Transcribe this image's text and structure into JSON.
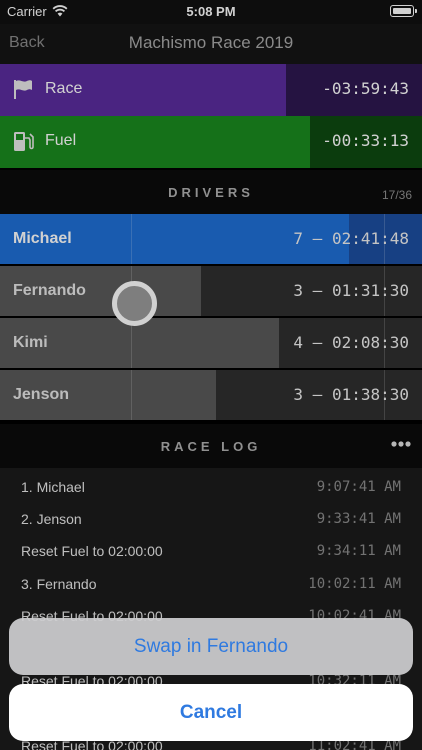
{
  "status_bar": {
    "carrier": "Carrier",
    "time": "5:08 PM"
  },
  "nav": {
    "back_label": "Back",
    "title": "Machismo Race 2019"
  },
  "timers": {
    "race": {
      "label": "Race",
      "value": "-03:59:43",
      "icon": "flag-icon",
      "color": "#5b2d9e"
    },
    "fuel": {
      "label": "Fuel",
      "value": "-00:33:13",
      "icon": "fuel-pump-icon",
      "color": "#1a8a1f"
    }
  },
  "drivers_section": {
    "title": "DRIVERS",
    "count": "17/36"
  },
  "drivers": [
    {
      "name": "Michael",
      "value": "7 — 02:41:48",
      "active": true
    },
    {
      "name": "Fernando",
      "value": "3 — 01:31:30",
      "active": false
    },
    {
      "name": "Kimi",
      "value": "4 — 02:08:30",
      "active": false
    },
    {
      "name": "Jenson",
      "value": "3 — 01:38:30",
      "active": false
    }
  ],
  "log_section": {
    "title": "RACE LOG",
    "more_icon": "more-icon"
  },
  "log": [
    {
      "entry": "1. Michael",
      "time": "9:07:41 AM"
    },
    {
      "entry": "2. Jenson",
      "time": "9:33:41 AM"
    },
    {
      "entry": "Reset Fuel to 02:00:00",
      "time": "9:34:11 AM"
    },
    {
      "entry": "3. Fernando",
      "time": "10:02:11 AM"
    },
    {
      "entry": "Reset Fuel to 02:00:00",
      "time": "10:02:41 AM"
    },
    {
      "entry": "",
      "time": ""
    },
    {
      "entry": "Reset Fuel to 02:00:00",
      "time": "10:32:11 AM"
    },
    {
      "entry": "",
      "time": ""
    },
    {
      "entry": "Reset Fuel to 02:00:00",
      "time": "11:02:41 AM"
    }
  ],
  "action_sheet": {
    "action_label": "Swap in Fernando",
    "cancel_label": "Cancel",
    "accent": "#2f7ae0"
  }
}
